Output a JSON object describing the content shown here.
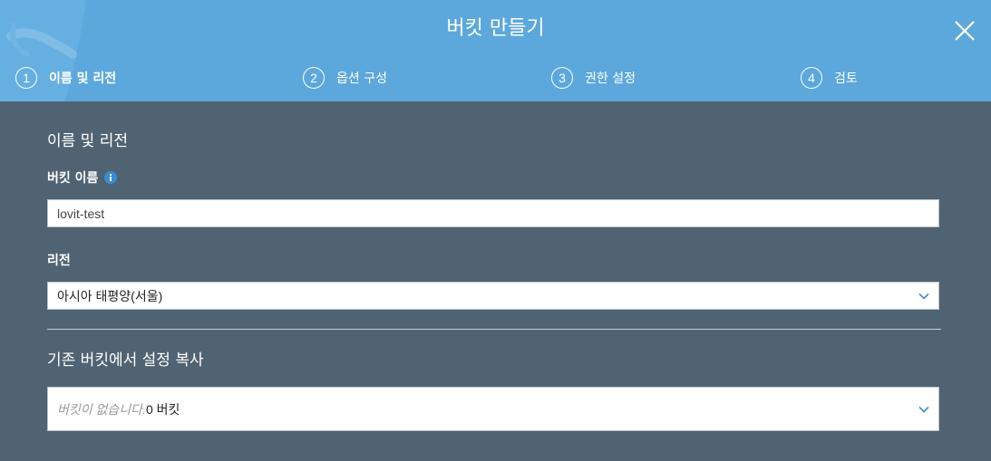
{
  "dialog": {
    "title": "버킷 만들기",
    "close_icon": "close-icon"
  },
  "steps": [
    {
      "number": "1",
      "label": "이름 및 리전",
      "active": true
    },
    {
      "number": "2",
      "label": "옵션 구성",
      "active": false
    },
    {
      "number": "3",
      "label": "권한 설정",
      "active": false
    },
    {
      "number": "4",
      "label": "검토",
      "active": false
    }
  ],
  "name_region": {
    "section_title": "이름 및 리전",
    "bucket_name_label": "버킷 이름",
    "bucket_name_value": "lovit-test",
    "region_label": "리전",
    "region_value": "아시아 태평양(서울)"
  },
  "copy_settings": {
    "section_title": "기존 버킷에서 설정 복사",
    "empty_text": "버킷이 없습니다.",
    "count_text": "0 버킷"
  },
  "colors": {
    "header_bg": "#5ca8dc",
    "body_bg": "#506372",
    "accent": "#3a8dd0"
  }
}
